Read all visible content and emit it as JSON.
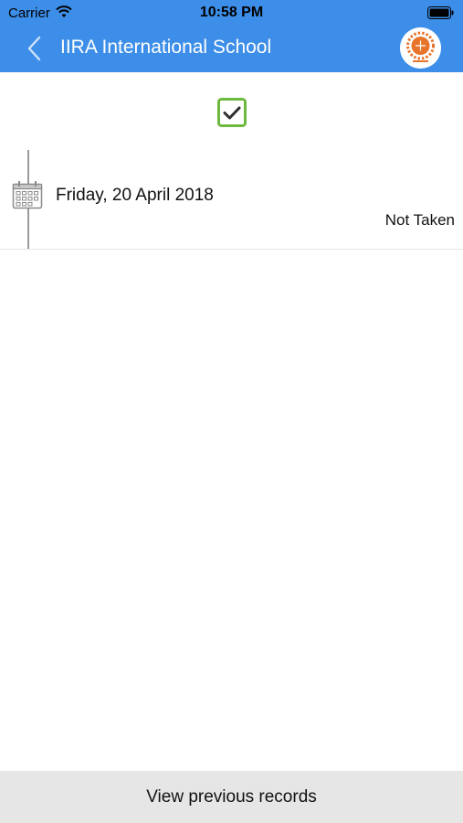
{
  "status_bar": {
    "carrier": "Carrier",
    "time": "10:58 PM",
    "wifi_icon": "wifi-icon",
    "battery_icon": "battery-icon"
  },
  "nav": {
    "title": "IIRA International School",
    "back_icon": "chevron-left-icon",
    "logo": "school-logo"
  },
  "attendance": {
    "checked_icon": "checkbox-checked-icon",
    "records": [
      {
        "date": "Friday, 20 April 2018",
        "status": "Not Taken",
        "icon": "calendar-icon"
      }
    ]
  },
  "footer": {
    "view_previous_label": "View previous records"
  },
  "colors": {
    "header_bg": "#3d8ee8",
    "check_green": "#6cb93e",
    "footer_bg": "#e6e6e6",
    "logo_orange": "#e8742b"
  }
}
